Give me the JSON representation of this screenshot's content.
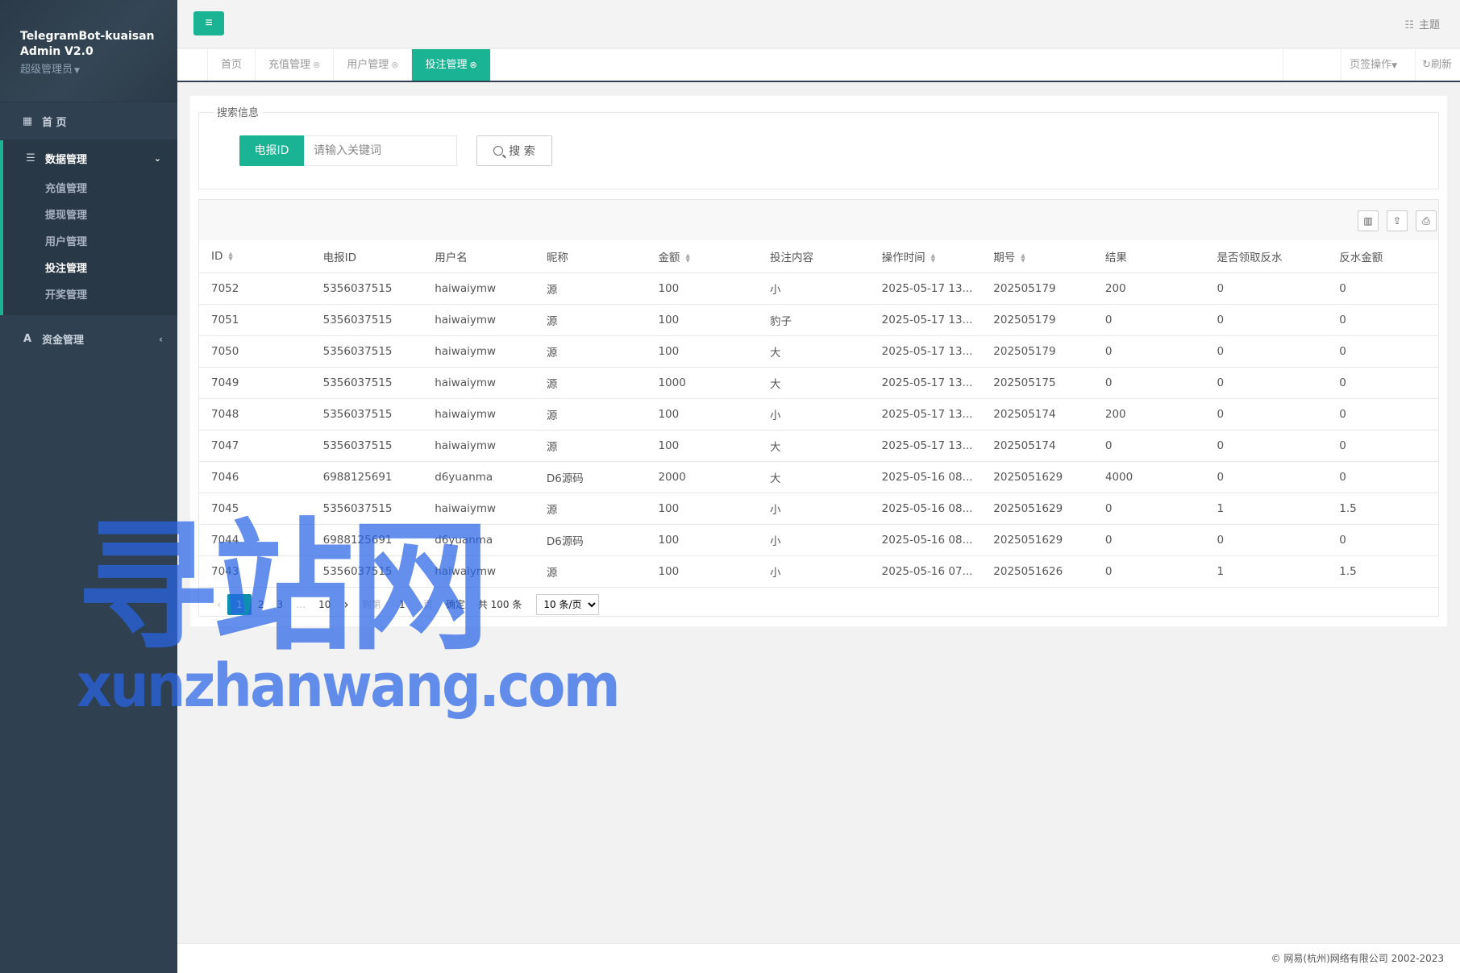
{
  "app": {
    "title_line1": "TelegramBot-kuaisan",
    "title_line2": "Admin V2.0",
    "role": "超级管理员"
  },
  "sidebar": {
    "home": "首 页",
    "data_group": "数据管理",
    "sub_items": [
      "充值管理",
      "提现管理",
      "用户管理",
      "投注管理",
      "开奖管理"
    ],
    "active_sub": "投注管理",
    "fund_group": "资金管理"
  },
  "topbar": {
    "theme_label": "主题"
  },
  "tabs": {
    "items": [
      "首页",
      "充值管理",
      "用户管理",
      "投注管理"
    ],
    "active": "投注管理",
    "page_ops": "页签操作",
    "refresh": "刷新"
  },
  "search": {
    "legend": "搜索信息",
    "field_label": "电报ID",
    "placeholder": "请输入关键词",
    "button": "搜 索"
  },
  "table": {
    "columns": [
      "ID",
      "电报ID",
      "用户名",
      "昵称",
      "金额",
      "投注内容",
      "操作时间",
      "期号",
      "结果",
      "是否领取反水",
      "反水金额"
    ],
    "rows": [
      [
        "7052",
        "5356037515",
        "haiwaiymw",
        "源",
        "100",
        "小",
        "2025-05-17 13...",
        "202505179",
        "200",
        "0",
        "0"
      ],
      [
        "7051",
        "5356037515",
        "haiwaiymw",
        "源",
        "100",
        "豹子",
        "2025-05-17 13...",
        "202505179",
        "0",
        "0",
        "0"
      ],
      [
        "7050",
        "5356037515",
        "haiwaiymw",
        "源",
        "100",
        "大",
        "2025-05-17 13...",
        "202505179",
        "0",
        "0",
        "0"
      ],
      [
        "7049",
        "5356037515",
        "haiwaiymw",
        "源",
        "1000",
        "大",
        "2025-05-17 13...",
        "202505175",
        "0",
        "0",
        "0"
      ],
      [
        "7048",
        "5356037515",
        "haiwaiymw",
        "源",
        "100",
        "小",
        "2025-05-17 13...",
        "202505174",
        "200",
        "0",
        "0"
      ],
      [
        "7047",
        "5356037515",
        "haiwaiymw",
        "源",
        "100",
        "大",
        "2025-05-17 13...",
        "202505174",
        "0",
        "0",
        "0"
      ],
      [
        "7046",
        "6988125691",
        "d6yuanma",
        "D6源码",
        "2000",
        "大",
        "2025-05-16 08...",
        "2025051629",
        "4000",
        "0",
        "0"
      ],
      [
        "7045",
        "5356037515",
        "haiwaiymw",
        "源",
        "100",
        "小",
        "2025-05-16 08...",
        "2025051629",
        "0",
        "1",
        "1.5"
      ],
      [
        "7044",
        "6988125691",
        "d6yuanma",
        "D6源码",
        "100",
        "小",
        "2025-05-16 08...",
        "2025051629",
        "0",
        "0",
        "0"
      ],
      [
        "7043",
        "5356037515",
        "haiwaiymw",
        "源",
        "100",
        "小",
        "2025-05-16 07...",
        "2025051626",
        "0",
        "1",
        "1.5"
      ]
    ]
  },
  "pagination": {
    "pages": [
      "1",
      "2",
      "3",
      "…",
      "10"
    ],
    "current": "1",
    "goto_label": "到第",
    "goto_value": "1",
    "page_unit": "页",
    "confirm": "确定",
    "total": "共 100 条",
    "per_page": "10 条/页"
  },
  "footer": {
    "copyright": "© 网易(杭州)网络有限公司 2002-2023"
  },
  "watermark": {
    "cn": "寻站网",
    "en": "xunzhanwang.com"
  },
  "colors": {
    "accent": "#1ab394",
    "sidebar_bg": "#2f4050",
    "pager_current": "#0e8fb0"
  }
}
